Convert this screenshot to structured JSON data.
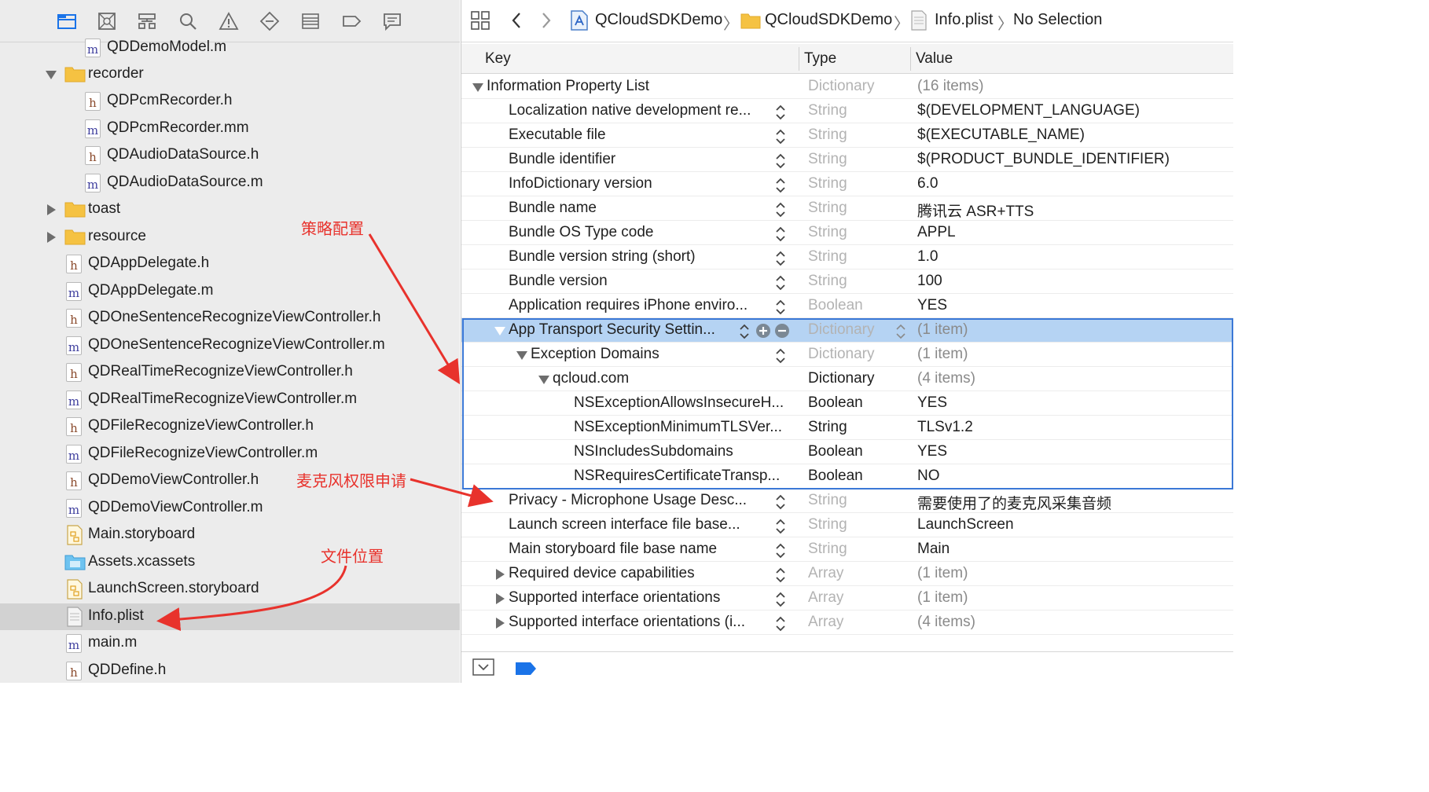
{
  "navigator": {
    "toolbar_icons": [
      "folder-icon",
      "source-control-icon",
      "hierarchy-icon",
      "search-icon",
      "warning-icon",
      "test-icon",
      "debug-icon",
      "breakpoint-icon",
      "report-icon"
    ],
    "items": [
      {
        "label": "QDDemoModel.m",
        "kind": "m"
      },
      {
        "label": "recorder",
        "kind": "folder",
        "expanded": true
      },
      {
        "label": "QDPcmRecorder.h",
        "kind": "h"
      },
      {
        "label": "QDPcmRecorder.mm",
        "kind": "m"
      },
      {
        "label": "QDAudioDataSource.h",
        "kind": "h"
      },
      {
        "label": "QDAudioDataSource.m",
        "kind": "m"
      },
      {
        "label": "toast",
        "kind": "folder",
        "expanded": false
      },
      {
        "label": "resource",
        "kind": "folder",
        "expanded": false
      },
      {
        "label": "QDAppDelegate.h",
        "kind": "h"
      },
      {
        "label": "QDAppDelegate.m",
        "kind": "m"
      },
      {
        "label": "QDOneSentenceRecognizeViewController.h",
        "kind": "h"
      },
      {
        "label": "QDOneSentenceRecognizeViewController.m",
        "kind": "m"
      },
      {
        "label": "QDRealTimeRecognizeViewController.h",
        "kind": "h"
      },
      {
        "label": "QDRealTimeRecognizeViewController.m",
        "kind": "m"
      },
      {
        "label": "QDFileRecognizeViewController.h",
        "kind": "h"
      },
      {
        "label": "QDFileRecognizeViewController.m",
        "kind": "m"
      },
      {
        "label": "QDDemoViewController.h",
        "kind": "h"
      },
      {
        "label": "QDDemoViewController.m",
        "kind": "m"
      },
      {
        "label": "Main.storyboard",
        "kind": "storyboard"
      },
      {
        "label": "Assets.xcassets",
        "kind": "xcassets"
      },
      {
        "label": "LaunchScreen.storyboard",
        "kind": "storyboard"
      },
      {
        "label": "Info.plist",
        "kind": "plist",
        "selected": true
      },
      {
        "label": "main.m",
        "kind": "m"
      },
      {
        "label": "QDDefine.h",
        "kind": "h"
      }
    ]
  },
  "jumpbar": {
    "project": "QCloudSDKDemo",
    "group": "QCloudSDKDemo",
    "file": "Info.plist",
    "selection": "No Selection"
  },
  "plist": {
    "headers": {
      "key": "Key",
      "type": "Type",
      "value": "Value"
    },
    "rows": [
      {
        "key": "Information Property List",
        "type": "Dictionary",
        "value": "(16 items)"
      },
      {
        "key": "Localization native development re...",
        "type": "String",
        "value": "$(DEVELOPMENT_LANGUAGE)"
      },
      {
        "key": "Executable file",
        "type": "String",
        "value": "$(EXECUTABLE_NAME)"
      },
      {
        "key": "Bundle identifier",
        "type": "String",
        "value": "$(PRODUCT_BUNDLE_IDENTIFIER)"
      },
      {
        "key": "InfoDictionary version",
        "type": "String",
        "value": "6.0"
      },
      {
        "key": "Bundle name",
        "type": "String",
        "value": "腾讯云 ASR+TTS"
      },
      {
        "key": "Bundle OS Type code",
        "type": "String",
        "value": "APPL"
      },
      {
        "key": "Bundle version string (short)",
        "type": "String",
        "value": "1.0"
      },
      {
        "key": "Bundle version",
        "type": "String",
        "value": "100"
      },
      {
        "key": "Application requires iPhone enviro...",
        "type": "Boolean",
        "value": "YES"
      },
      {
        "key": "App Transport Security Settin...",
        "type": "Dictionary",
        "value": "(1 item)"
      },
      {
        "key": "Exception Domains",
        "type": "Dictionary",
        "value": "(1 item)"
      },
      {
        "key": "qcloud.com",
        "type": "Dictionary",
        "value": "(4 items)"
      },
      {
        "key": "NSExceptionAllowsInsecureH...",
        "type": "Boolean",
        "value": "YES"
      },
      {
        "key": "NSExceptionMinimumTLSVer...",
        "type": "String",
        "value": "TLSv1.2"
      },
      {
        "key": "NSIncludesSubdomains",
        "type": "Boolean",
        "value": "YES"
      },
      {
        "key": "NSRequiresCertificateTransp...",
        "type": "Boolean",
        "value": "NO"
      },
      {
        "key": "Privacy - Microphone Usage Desc...",
        "type": "String",
        "value": "需要使用了的麦克风采集音频"
      },
      {
        "key": "Launch screen interface file base...",
        "type": "String",
        "value": "LaunchScreen"
      },
      {
        "key": "Main storyboard file base name",
        "type": "String",
        "value": "Main"
      },
      {
        "key": "Required device capabilities",
        "type": "Array",
        "value": "(1 item)"
      },
      {
        "key": "Supported interface orientations",
        "type": "Array",
        "value": "(1 item)"
      },
      {
        "key": "Supported interface orientations (i...",
        "type": "Array",
        "value": "(4 items)"
      }
    ]
  },
  "annotations": {
    "policy_config": "策略配置",
    "mic_permission": "麦克风权限申请",
    "file_location": "文件位置"
  },
  "colors": {
    "annotation_red": "#e8322c",
    "selection_blue": "#b5d3f3",
    "box_blue": "#3b78d6",
    "folder_yellow": "#f5c242"
  }
}
